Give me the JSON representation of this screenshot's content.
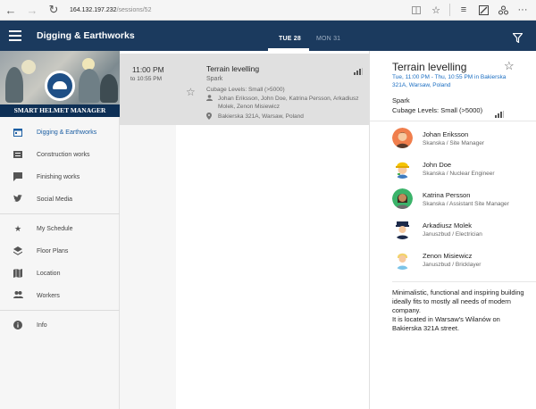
{
  "browser": {
    "url_host": "164.132.197.232",
    "url_path": "/sessions/52"
  },
  "header": {
    "title": "Digging & Earthworks",
    "tabs": [
      {
        "label": "TUE 28",
        "active": true
      },
      {
        "label": "MON 31",
        "active": false
      }
    ],
    "color": "#1b3a5e"
  },
  "logo": {
    "text": "SMART HELMET MANAGER"
  },
  "sidebar": {
    "items": [
      {
        "label": "Digging & Earthworks",
        "icon": "calendar-icon",
        "active": true
      },
      {
        "label": "Construction works",
        "icon": "list-icon",
        "active": false
      },
      {
        "label": "Finishing works",
        "icon": "chat-icon",
        "active": false
      },
      {
        "label": "Social Media",
        "icon": "twitter-icon",
        "active": false
      },
      {
        "label": "My Schedule",
        "icon": "star-icon",
        "active": false
      },
      {
        "label": "Floor Plans",
        "icon": "layers-icon",
        "active": false
      },
      {
        "label": "Location",
        "icon": "map-icon",
        "active": false
      },
      {
        "label": "Workers",
        "icon": "people-icon",
        "active": false
      },
      {
        "label": "Info",
        "icon": "info-icon",
        "active": false
      }
    ],
    "accent": "#1b5ea3"
  },
  "session": {
    "start": "11:00 PM",
    "end": "to 10:55 PM",
    "title": "Terrain levelling",
    "track": "Spark",
    "cubage": "Cubage Levels: Small (>5000)",
    "speakers": "Johan Eriksson, John Doe, Katrina Persson, Arkadiusz Molek, Zenon Misiewicz",
    "location": "Bakierska 321A, Warsaw, Poland"
  },
  "detail": {
    "title": "Terrain levelling",
    "time": "Tue, 11:00 PM - Thu, 10:55 PM in Bakierska 321A, Warsaw, Poland",
    "track": "Spark",
    "cubage": "Cubage Levels: Small (>5000)",
    "speakers": [
      {
        "name": "Johan Eriksson",
        "role": "Skanska / Site Manager",
        "avatar": "avatar-orange"
      },
      {
        "name": "John Doe",
        "role": "Skanska / Nuclear Engineer",
        "avatar": "avatar-yellow-helmet"
      },
      {
        "name": "Katrina Persson",
        "role": "Skanska / Assistant Site Manager",
        "avatar": "avatar-green"
      },
      {
        "name": "Arkadiusz Molek",
        "role": "Januszbud / Electrician",
        "avatar": "avatar-police"
      },
      {
        "name": "Zenon Misiewicz",
        "role": "Januszbud / Bricklayer",
        "avatar": "avatar-blond"
      }
    ],
    "description": "Minimalistic, functional and inspiring building ideally fits to mostly all needs of modern company.",
    "description2": "It is located in Warsaw's Wilanów on Bakierska 321A street.",
    "time_color": "#1b6ec2"
  }
}
